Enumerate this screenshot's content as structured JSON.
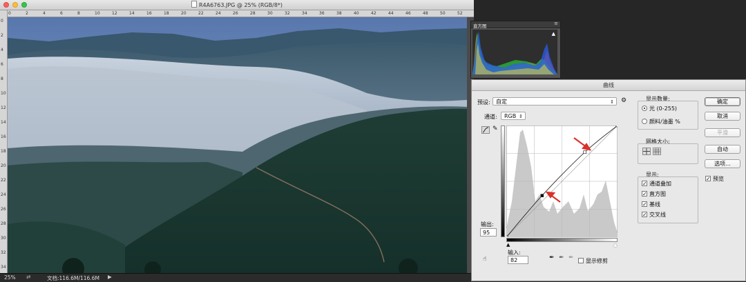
{
  "document": {
    "title": "R4A6763.JPG @ 25% (RGB/8*)",
    "ruler_top_labels": [
      "0",
      "2",
      "4",
      "6",
      "8",
      "10",
      "12",
      "14",
      "16",
      "18",
      "20",
      "22",
      "24",
      "26",
      "28",
      "30",
      "32",
      "34",
      "36",
      "38",
      "40",
      "42",
      "44",
      "46",
      "48",
      "50",
      "52"
    ],
    "ruler_left_labels": [
      "0",
      "2",
      "4",
      "6",
      "8",
      "10",
      "12",
      "14",
      "16",
      "18",
      "20",
      "22",
      "24",
      "26",
      "28",
      "30",
      "32",
      "34"
    ],
    "status_zoom": "25%",
    "status_doc": "文档:116.6M/116.6M",
    "status_arrow": "▶"
  },
  "histogram_panel": {
    "tab_label": "直方图",
    "menu_icon": "≡",
    "warning_icon": "▲"
  },
  "curves": {
    "title": "曲线",
    "preset_label": "预设:",
    "preset_value": "自定",
    "channel_label": "通道:",
    "channel_value": "RGB",
    "output_label": "输出:",
    "output_value": "95",
    "input_label": "输入:",
    "input_value": "82",
    "show_clipping_label": "显示修剪",
    "show_clipping": false,
    "display_amount": {
      "title": "显示数量:",
      "light_label": "光 (0-255)",
      "pigment_label": "颜料/油墨 %",
      "selected": "light"
    },
    "grid_size": {
      "title": "网格大小:"
    },
    "show": {
      "title": "显示:",
      "items": [
        {
          "label": "通道叠加",
          "checked": true
        },
        {
          "label": "直方图",
          "checked": true
        },
        {
          "label": "基线",
          "checked": true
        },
        {
          "label": "交叉线",
          "checked": true
        }
      ]
    },
    "buttons": {
      "ok": "确定",
      "cancel": "取消",
      "smooth": "平滑",
      "auto": "自动",
      "options": "选项..."
    },
    "preview_label": "预览",
    "preview": true,
    "curve_points": [
      [
        0,
        0
      ],
      [
        82,
        95
      ],
      [
        180,
        194
      ],
      [
        255,
        255
      ]
    ],
    "highlight_color": "#d9312b"
  }
}
